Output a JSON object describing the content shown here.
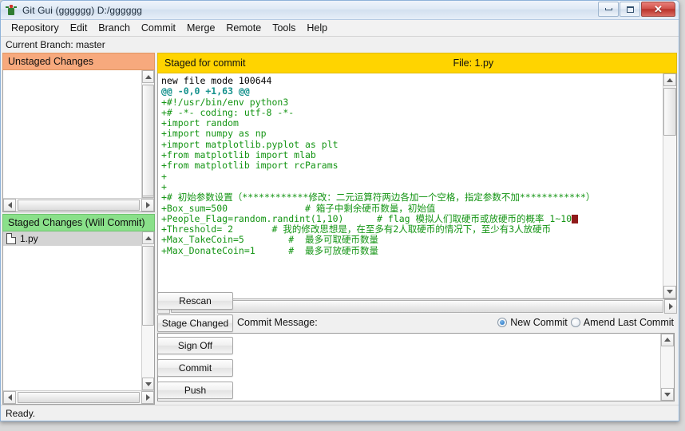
{
  "window": {
    "title": "Git Gui (gggggg) D:/gggggg",
    "app_icon": "git-logo-icon",
    "controls": {
      "minimize": "minimize-icon",
      "maximize": "maximize-icon",
      "close": "✕"
    }
  },
  "menubar": {
    "items": [
      {
        "label": "Repository"
      },
      {
        "label": "Edit"
      },
      {
        "label": "Branch"
      },
      {
        "label": "Commit"
      },
      {
        "label": "Merge"
      },
      {
        "label": "Remote"
      },
      {
        "label": "Tools"
      },
      {
        "label": "Help"
      }
    ]
  },
  "branchbar": {
    "text": "Current Branch: master"
  },
  "left_panel": {
    "unstaged": {
      "header": "Unstaged Changes",
      "header_color": "#f7a97d",
      "files": []
    },
    "staged": {
      "header": "Staged Changes (Will Commit)",
      "header_color": "#8ae08a",
      "files": [
        {
          "name": "1.py",
          "icon": "file-icon"
        }
      ]
    }
  },
  "diff_panel": {
    "header_label": "Staged for commit",
    "header_color": "#ffd400",
    "file_label": "File:  1.py",
    "lines": [
      {
        "text": "new file mode 100644",
        "kind": "plain"
      },
      {
        "text": "@@ -0,0 +1,63 @@",
        "kind": "hunk"
      },
      {
        "text": "+#!/usr/bin/env python3",
        "kind": "add"
      },
      {
        "text": "+# -*- coding: utf-8 -*-",
        "kind": "add"
      },
      {
        "text": "+import random",
        "kind": "add"
      },
      {
        "text": "+import numpy as np",
        "kind": "add"
      },
      {
        "text": "+import matplotlib.pyplot as plt",
        "kind": "add"
      },
      {
        "text": "+from matplotlib import mlab",
        "kind": "add"
      },
      {
        "text": "+from matplotlib import rcParams",
        "kind": "add"
      },
      {
        "text": "+",
        "kind": "add"
      },
      {
        "text": "+",
        "kind": "add"
      },
      {
        "text": "+# 初始参数设置（************修改：二元运算符两边各加一个空格，指定参数不加************）",
        "kind": "add"
      },
      {
        "text": "+Box_sum=500              # 箱子中剩余硬币数量，初始值",
        "kind": "add"
      },
      {
        "text": "+People_Flag=random.randint(1,10)      # flag 模拟人们取硬币或放硬币的概率 1~10",
        "kind": "add",
        "caret_at_end": true
      },
      {
        "text": "+Threshold= 2       # 我的修改思想是，在至多有2人取硬币的情况下，至少有3人放硬币",
        "kind": "add"
      },
      {
        "text": "+Max_TakeCoin=5        #  最多可取硬币数量",
        "kind": "add"
      },
      {
        "text": "+Max_DonateCoin=1      #  最多可放硬币数量",
        "kind": "add"
      }
    ],
    "colors": {
      "added": "#139413",
      "hunk": "#14918c",
      "plain": "#000000",
      "caret": "#8f1a1a"
    }
  },
  "commit_section": {
    "label": "Commit Message:",
    "message_value": "",
    "radios": [
      {
        "label": "New Commit",
        "selected": true
      },
      {
        "label": "Amend Last Commit",
        "selected": false
      }
    ],
    "buttons": [
      {
        "label": "Rescan"
      },
      {
        "label": "Stage Changed"
      },
      {
        "label": "Sign Off"
      },
      {
        "label": "Commit"
      },
      {
        "label": "Push"
      }
    ]
  },
  "statusbar": {
    "text": "Ready."
  }
}
